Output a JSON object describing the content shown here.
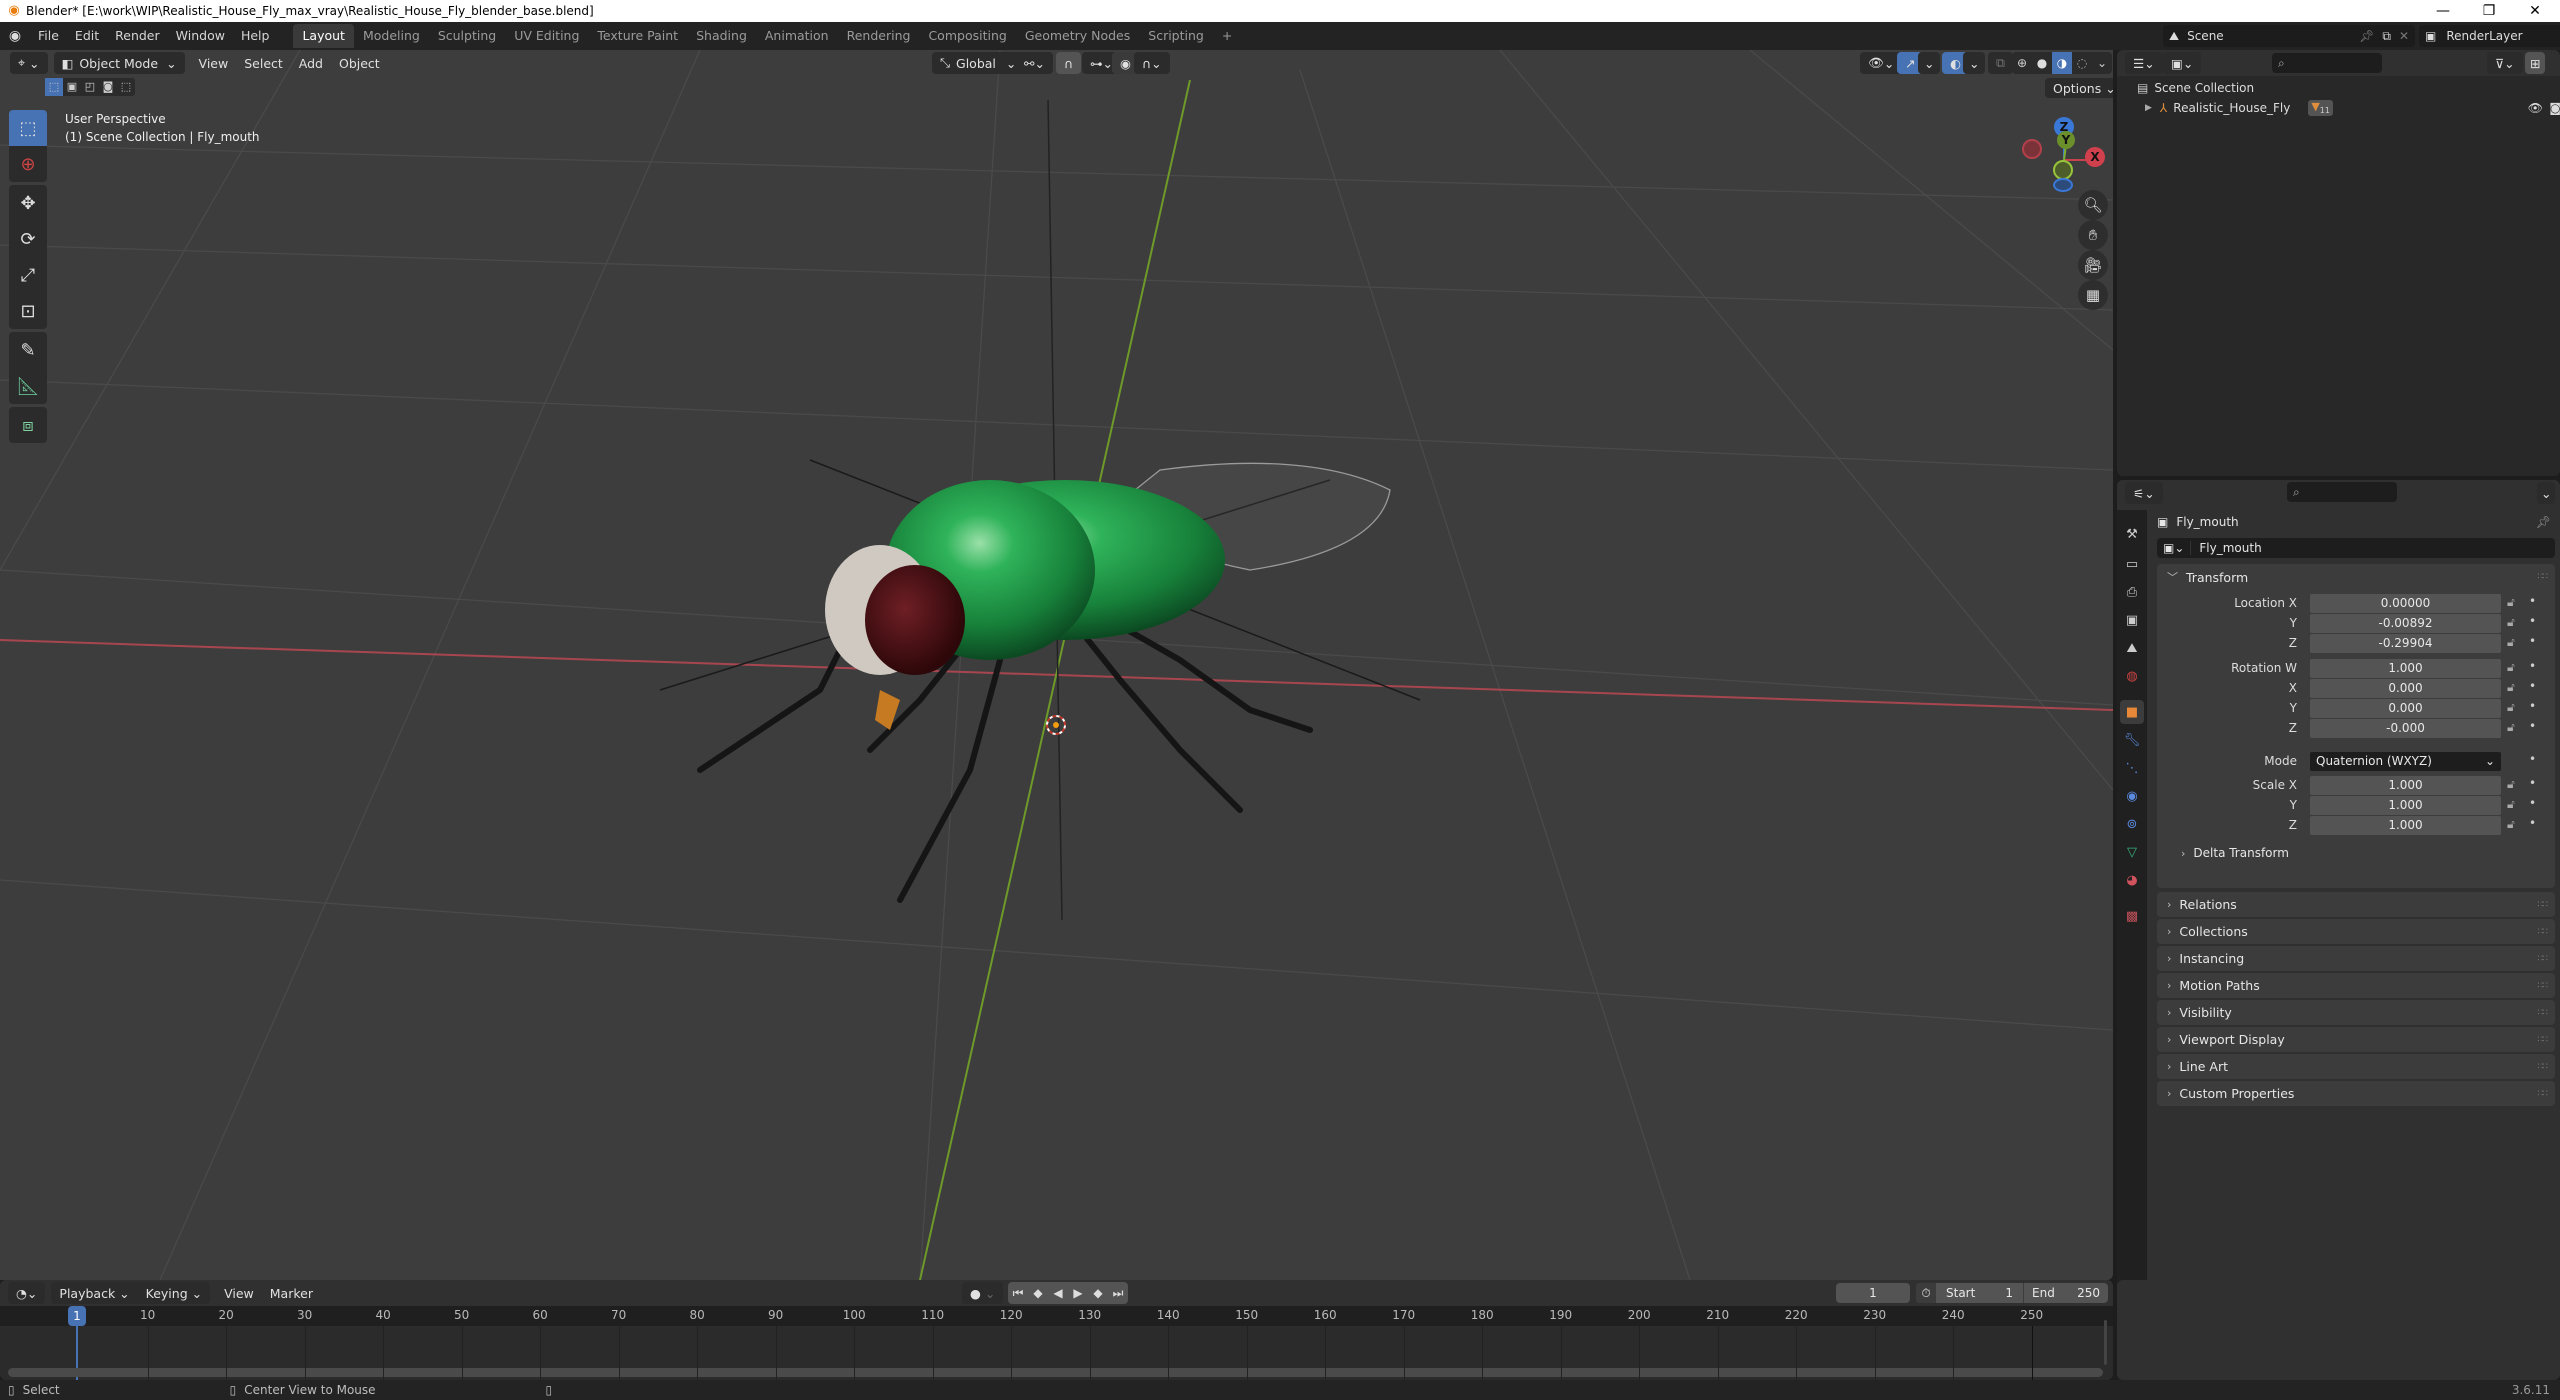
{
  "window": {
    "title": "Blender* [E:\\work\\WIP\\Realistic_House_Fly_max_vray\\Realistic_House_Fly_blender_base.blend]",
    "controls": {
      "minimize": "—",
      "maximize": "❐",
      "close": "✕"
    }
  },
  "menu": [
    "File",
    "Edit",
    "Render",
    "Window",
    "Help"
  ],
  "workspaces": [
    "Layout",
    "Modeling",
    "Sculpting",
    "UV Editing",
    "Texture Paint",
    "Shading",
    "Animation",
    "Rendering",
    "Compositing",
    "Geometry Nodes",
    "Scripting"
  ],
  "active_workspace": "Layout",
  "add_workspace": "+",
  "scene": {
    "label": "Scene",
    "view_layer": "RenderLayer"
  },
  "viewport": {
    "mode": "Object Mode",
    "menus": [
      "View",
      "Select",
      "Add",
      "Object"
    ],
    "transform_orientation": "Global",
    "options_label": "Options",
    "overlay_title": "User Perspective",
    "overlay_subtitle": "(1) Scene Collection | Fly_mouth",
    "gizmo": {
      "x": "X",
      "y": "Y",
      "z": "Z"
    },
    "colors": {
      "x_axis": "#c8424d",
      "y_axis": "#7fae2e",
      "z_axis": "#3a78d8",
      "selected": "#4772b3"
    },
    "tools": [
      "select-box",
      "cursor",
      "move",
      "rotate",
      "scale",
      "transform",
      "annotate",
      "measure",
      "add-cube"
    ],
    "nav_icons": [
      "zoom",
      "pan",
      "camera",
      "grid"
    ]
  },
  "outliner": {
    "root": "Scene Collection",
    "items": [
      {
        "name": "Realistic_House_Fly",
        "badge": "11"
      }
    ]
  },
  "properties": {
    "object_name": "Fly_mouth",
    "data_name": "Fly_mouth",
    "transform": {
      "title": "Transform",
      "location": {
        "label": "Location X",
        "x": "0.00000",
        "y": "-0.00892",
        "z": "-0.29904"
      },
      "rotation": {
        "label": "Rotation W",
        "w": "1.000",
        "x": "0.000",
        "y": "0.000",
        "z": "-0.000"
      },
      "mode_label": "Mode",
      "mode_value": "Quaternion (WXYZ)",
      "scale": {
        "label": "Scale X",
        "x": "1.000",
        "y": "1.000",
        "z": "1.000"
      },
      "axis_labels": {
        "x": "X",
        "y": "Y",
        "z": "Z"
      },
      "delta": "Delta Transform"
    },
    "sections": [
      "Relations",
      "Collections",
      "Instancing",
      "Motion Paths",
      "Visibility",
      "Viewport Display",
      "Line Art",
      "Custom Properties"
    ]
  },
  "timeline": {
    "menus": [
      "Playback",
      "Keying",
      "View",
      "Marker"
    ],
    "current_frame": "1",
    "start_label": "Start",
    "start": "1",
    "end_label": "End",
    "end": "250",
    "ticks": [
      "10",
      "20",
      "30",
      "40",
      "50",
      "60",
      "70",
      "80",
      "90",
      "100",
      "110",
      "120",
      "130",
      "140",
      "150",
      "160",
      "170",
      "180",
      "190",
      "200",
      "210",
      "220",
      "230",
      "240",
      "250"
    ],
    "playhead": "1"
  },
  "status": {
    "select": "Select",
    "center": "Center View to Mouse",
    "version": "3.6.11"
  }
}
